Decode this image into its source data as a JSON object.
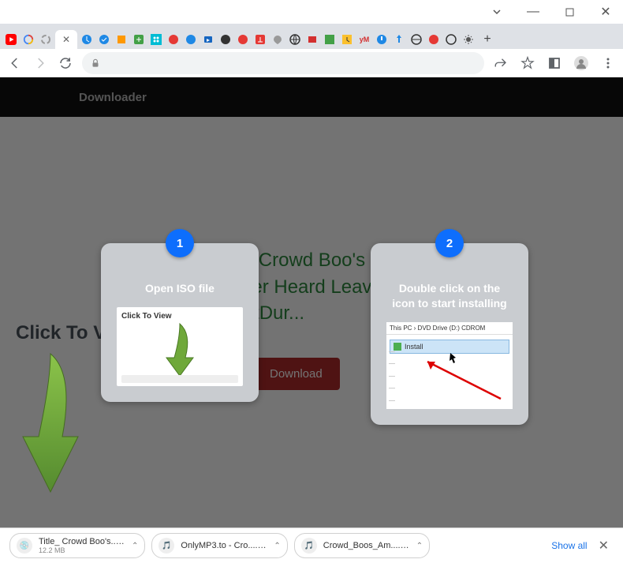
{
  "window": {
    "drop": "▾",
    "min": "—",
    "max": "□",
    "close": "✕"
  },
  "tabs": {
    "new": "+"
  },
  "header": {
    "title": "Downloader"
  },
  "hero": {
    "title_l1": "Title: Crowd Boo's",
    "title_l2": "Amber Heard Leaving",
    "title_l3": "CourtDur...",
    "download": "Download"
  },
  "overlay": {
    "click_to_view": "Click To View"
  },
  "card1": {
    "num": "1",
    "title": "Open ISO file",
    "thumb_label": "Click To View"
  },
  "card2": {
    "num": "2",
    "title": "Double click on the icon to start installing",
    "crumb": "This PC › DVD Drive (D:) CDROM",
    "install": "Install"
  },
  "downloads": {
    "item1": {
      "name": "Title_ Crowd Boo's....iso",
      "size": "12.2 MB"
    },
    "item2": {
      "name": "OnlyMP3.to - Cro....mp3"
    },
    "item3": {
      "name": "Crowd_Boos_Am....mp3"
    },
    "show_all": "Show all"
  }
}
